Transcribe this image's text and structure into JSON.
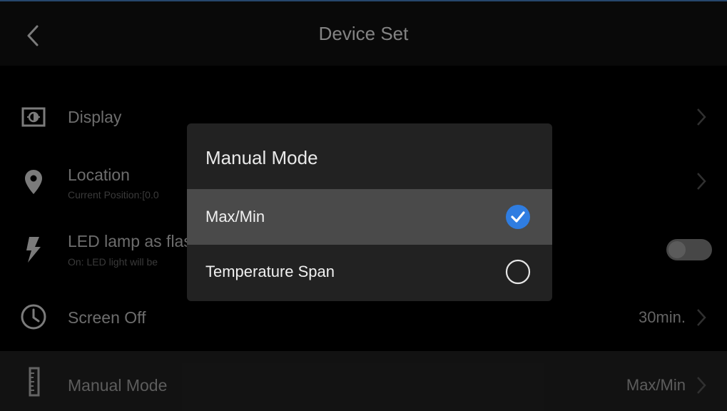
{
  "header": {
    "title": "Device Set",
    "back_icon": "back-chevron-icon"
  },
  "settings": {
    "display": {
      "label": "Display",
      "icon": "display-brightness-icon"
    },
    "location": {
      "label": "Location",
      "sub": "Current Position:[0.0",
      "icon": "location-pin-icon"
    },
    "led": {
      "label": "LED lamp as flas",
      "sub": "On: LED light will be",
      "icon": "flash-icon",
      "toggle_on": false
    },
    "screen_off": {
      "label": "Screen Off",
      "value": "30min.",
      "icon": "clock-icon"
    },
    "manual_mode": {
      "label": "Manual Mode",
      "value": "Max/Min",
      "icon": "ruler-icon"
    }
  },
  "dialog": {
    "title": "Manual Mode",
    "options": [
      {
        "label": "Max/Min",
        "selected": true
      },
      {
        "label": "Temperature Span",
        "selected": false
      }
    ]
  },
  "colors": {
    "accent": "#2f7de1",
    "dialog_bg": "#222222",
    "active_option_bg": "#4a4a4a"
  }
}
